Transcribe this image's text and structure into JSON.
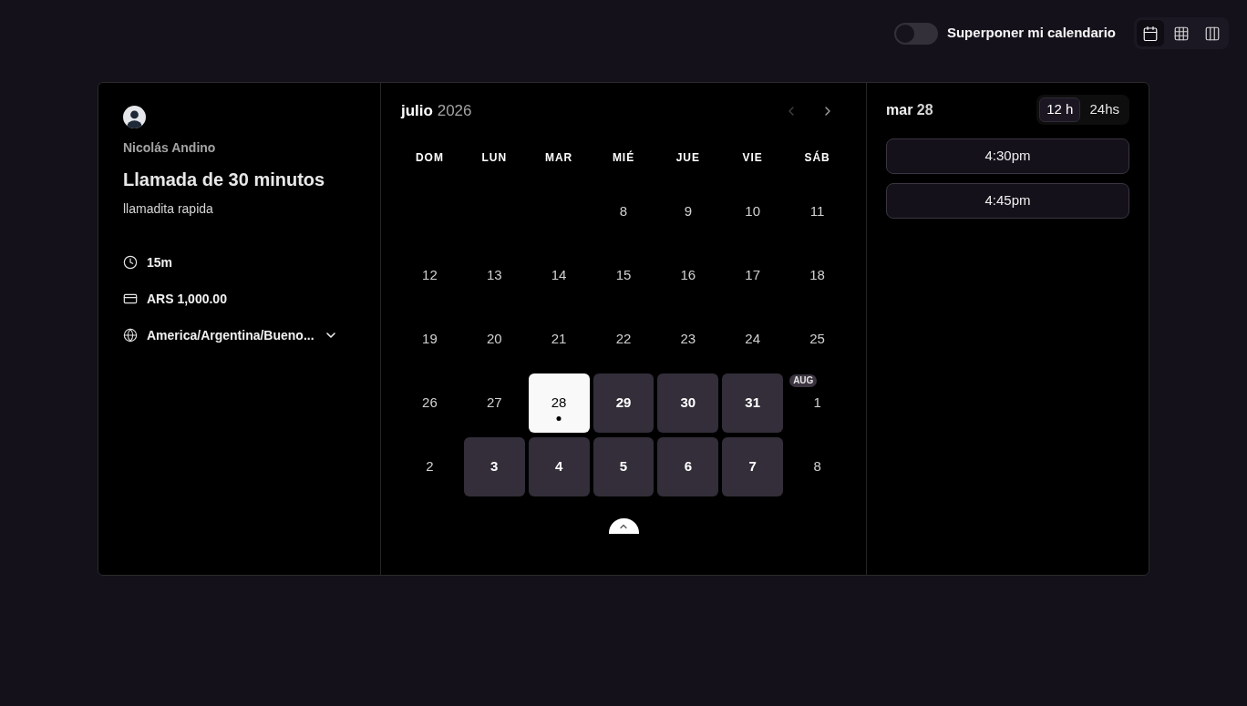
{
  "top_bar": {
    "overlay_toggle": {
      "label": "Superponer mi calendario",
      "on": false
    },
    "view_options": [
      {
        "kind": "month",
        "selected": true
      },
      {
        "kind": "weekly",
        "selected": false
      },
      {
        "kind": "column",
        "selected": false
      }
    ]
  },
  "event": {
    "host": "Nicolás Andino",
    "title": "Llamada de 30 minutos",
    "description": "llamadita rapida",
    "details": [
      {
        "kind": "duration",
        "text": "15m"
      },
      {
        "kind": "price",
        "text": "ARS 1,000.00"
      },
      {
        "kind": "timezone",
        "text": "America/Argentina/Bueno..."
      }
    ]
  },
  "calendar": {
    "month": "julio",
    "year": "2026",
    "nav": {
      "previous": {
        "disabled": true
      },
      "next": {
        "disabled": false
      }
    },
    "weekdays": [
      "DOM",
      "LUN",
      "MAR",
      "MIÉ",
      "JUE",
      "VIE",
      "SÁB"
    ],
    "days": [
      {
        "kind": "empty"
      },
      {
        "kind": "empty"
      },
      {
        "kind": "empty"
      },
      {
        "kind": "day",
        "label": "8",
        "available": false,
        "selected": false,
        "today": false
      },
      {
        "kind": "day",
        "label": "9",
        "available": false,
        "selected": false,
        "today": false
      },
      {
        "kind": "day",
        "label": "10",
        "available": false,
        "selected": false,
        "today": false
      },
      {
        "kind": "day",
        "label": "11",
        "available": false,
        "selected": false,
        "today": false
      },
      {
        "kind": "day",
        "label": "12",
        "available": false,
        "selected": false,
        "today": false
      },
      {
        "kind": "day",
        "label": "13",
        "available": false,
        "selected": false,
        "today": false
      },
      {
        "kind": "day",
        "label": "14",
        "available": false,
        "selected": false,
        "today": false
      },
      {
        "kind": "day",
        "label": "15",
        "available": false,
        "selected": false,
        "today": false
      },
      {
        "kind": "day",
        "label": "16",
        "available": false,
        "selected": false,
        "today": false
      },
      {
        "kind": "day",
        "label": "17",
        "available": false,
        "selected": false,
        "today": false
      },
      {
        "kind": "day",
        "label": "18",
        "available": false,
        "selected": false,
        "today": false
      },
      {
        "kind": "day",
        "label": "19",
        "available": false,
        "selected": false,
        "today": false
      },
      {
        "kind": "day",
        "label": "20",
        "available": false,
        "selected": false,
        "today": false
      },
      {
        "kind": "day",
        "label": "21",
        "available": false,
        "selected": false,
        "today": false
      },
      {
        "kind": "day",
        "label": "22",
        "available": false,
        "selected": false,
        "today": false
      },
      {
        "kind": "day",
        "label": "23",
        "available": false,
        "selected": false,
        "today": false
      },
      {
        "kind": "day",
        "label": "24",
        "available": false,
        "selected": false,
        "today": false
      },
      {
        "kind": "day",
        "label": "25",
        "available": false,
        "selected": false,
        "today": false
      },
      {
        "kind": "day",
        "label": "26",
        "available": false,
        "selected": false,
        "today": false
      },
      {
        "kind": "day",
        "label": "27",
        "available": false,
        "selected": false,
        "today": false
      },
      {
        "kind": "day",
        "label": "28",
        "available": true,
        "selected": true,
        "today": true
      },
      {
        "kind": "day",
        "label": "29",
        "available": true,
        "selected": false,
        "today": false
      },
      {
        "kind": "day",
        "label": "30",
        "available": true,
        "selected": false,
        "today": false
      },
      {
        "kind": "day",
        "label": "31",
        "available": true,
        "selected": false,
        "today": false
      },
      {
        "kind": "day",
        "label": "1",
        "month_badge": "AUG",
        "available": false,
        "selected": false,
        "today": false
      },
      {
        "kind": "day",
        "label": "2",
        "available": false,
        "selected": false,
        "today": false
      },
      {
        "kind": "day",
        "label": "3",
        "available": true,
        "selected": false,
        "today": false
      },
      {
        "kind": "day",
        "label": "4",
        "available": true,
        "selected": false,
        "today": false
      },
      {
        "kind": "day",
        "label": "5",
        "available": true,
        "selected": false,
        "today": false
      },
      {
        "kind": "day",
        "label": "6",
        "available": true,
        "selected": false,
        "today": false
      },
      {
        "kind": "day",
        "label": "7",
        "available": true,
        "selected": false,
        "today": false
      },
      {
        "kind": "day",
        "label": "8",
        "available": false,
        "selected": false,
        "today": false
      }
    ]
  },
  "schedule": {
    "weekday": "mar",
    "day": "28",
    "time_format": [
      {
        "label": "12 h",
        "selected": true
      },
      {
        "label": "24hs",
        "selected": false
      }
    ],
    "slots": [
      "4:30pm",
      "4:45pm"
    ]
  }
}
